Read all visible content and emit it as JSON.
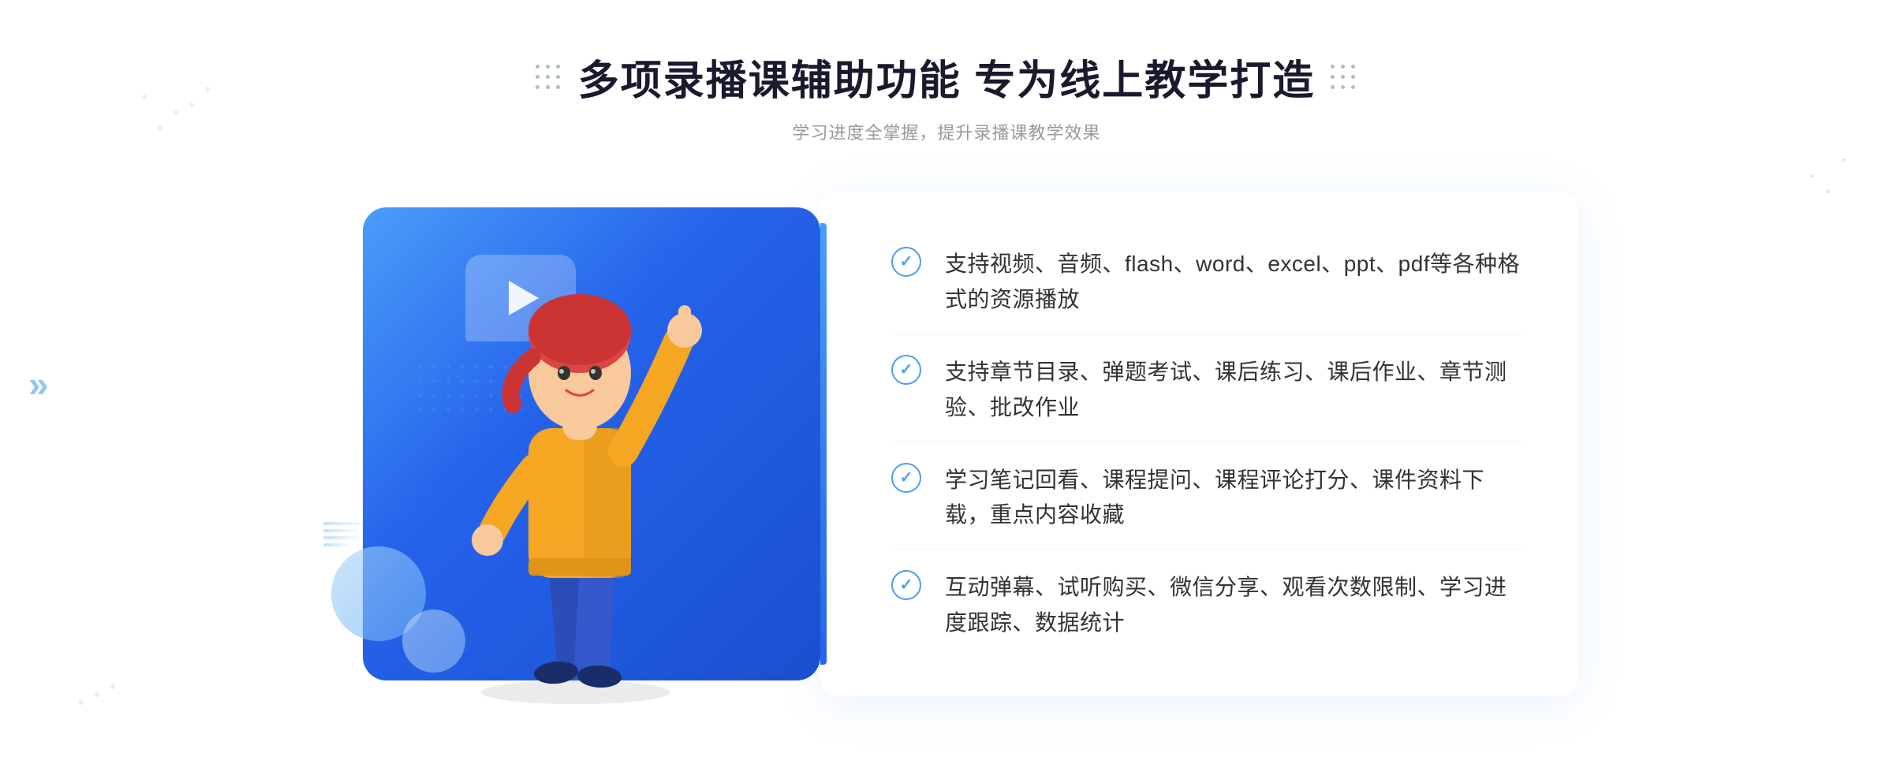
{
  "header": {
    "title": "多项录播课辅助功能 专为线上教学打造",
    "subtitle": "学习进度全掌握，提升录播课教学效果",
    "title_decoration_label": "decorative dots"
  },
  "features": [
    {
      "id": 1,
      "text": "支持视频、音频、flash、word、excel、ppt、pdf等各种格式的资源播放"
    },
    {
      "id": 2,
      "text": "支持章节目录、弹题考试、课后练习、课后作业、章节测验、批改作业"
    },
    {
      "id": 3,
      "text": "学习笔记回看、课程提问、课程评论打分、课件资料下载，重点内容收藏"
    },
    {
      "id": 4,
      "text": "互动弹幕、试听购买、微信分享、观看次数限制、学习进度跟踪、数据统计"
    }
  ],
  "illustration": {
    "play_button_label": "play",
    "alt": "教学插图"
  },
  "colors": {
    "primary": "#4a9df8",
    "primary_dark": "#2563eb",
    "text_dark": "#1a1a2e",
    "text_gray": "#999999",
    "text_body": "#333333",
    "white": "#ffffff",
    "check_color": "#4a9df8"
  }
}
